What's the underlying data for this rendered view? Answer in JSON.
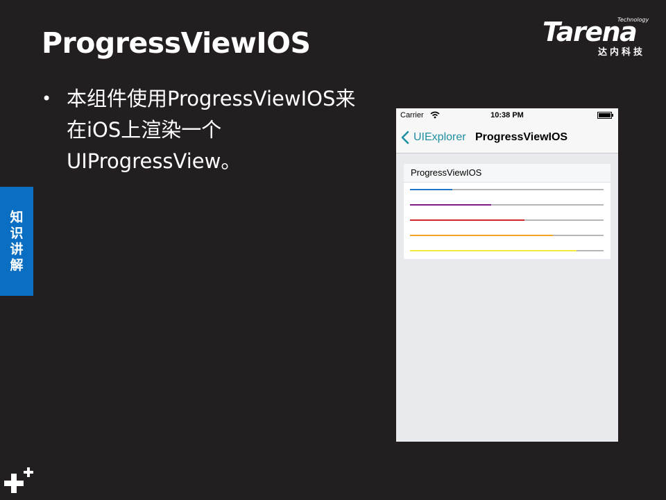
{
  "slide": {
    "title": "ProgressViewIOS",
    "bullet_line1": "本组件使用ProgressViewIOS来",
    "bullet_line2": "在iOS上渲染一个",
    "bullet_line3": "UIProgressView。",
    "bullet_glyph": "•",
    "side_tab": [
      "知",
      "识",
      "讲",
      "解"
    ]
  },
  "logo": {
    "main": "Tarena",
    "tech": "Technology",
    "sub": "达内科技"
  },
  "phone": {
    "status": {
      "carrier": "Carrier",
      "time": "10:38 PM"
    },
    "nav": {
      "back_label": "UIExplorer",
      "title": "ProgressViewIOS"
    },
    "card": {
      "header": "ProgressViewIOS",
      "bars": [
        {
          "progress": 0.22,
          "color": "#1f76c4"
        },
        {
          "progress": 0.42,
          "color": "#7e1a8a"
        },
        {
          "progress": 0.59,
          "color": "#d3262b"
        },
        {
          "progress": 0.74,
          "color": "#f0a126"
        },
        {
          "progress": 0.86,
          "color": "#f3e93c"
        }
      ]
    }
  },
  "colors": {
    "background": "#231f20",
    "side_tab": "#0a6fc2",
    "ios_tint": "#1c8fa0"
  }
}
